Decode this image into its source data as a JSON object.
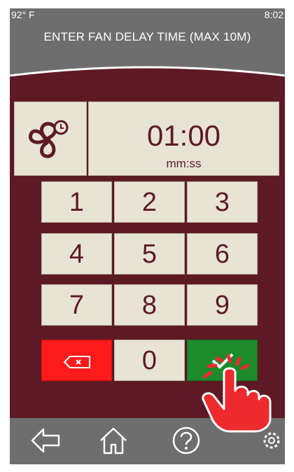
{
  "status": {
    "temperature": "92° F",
    "time": "8:02"
  },
  "header": {
    "title": "ENTER FAN DELAY TIME (MAX 10M)"
  },
  "display": {
    "icon": "fan-delay-icon",
    "value": "01:00",
    "unit": "mm:ss"
  },
  "keypad": {
    "keys": [
      "1",
      "2",
      "3",
      "4",
      "5",
      "6",
      "7",
      "8",
      "9"
    ],
    "zero": "0",
    "backspace_icon": "backspace-icon",
    "enter_icon": "confirm-icon"
  },
  "nav": {
    "items": [
      "back-arrow-icon",
      "home-icon",
      "help-icon",
      "settings-icon"
    ]
  },
  "colors": {
    "maroon": "#5e1a24",
    "panel": "#e7e4d6",
    "header_gray": "#6e6e6e",
    "delete_red": "#ff1b1b",
    "enter_green": "#1c8b2b",
    "hand_red": "#ee2a2f"
  }
}
